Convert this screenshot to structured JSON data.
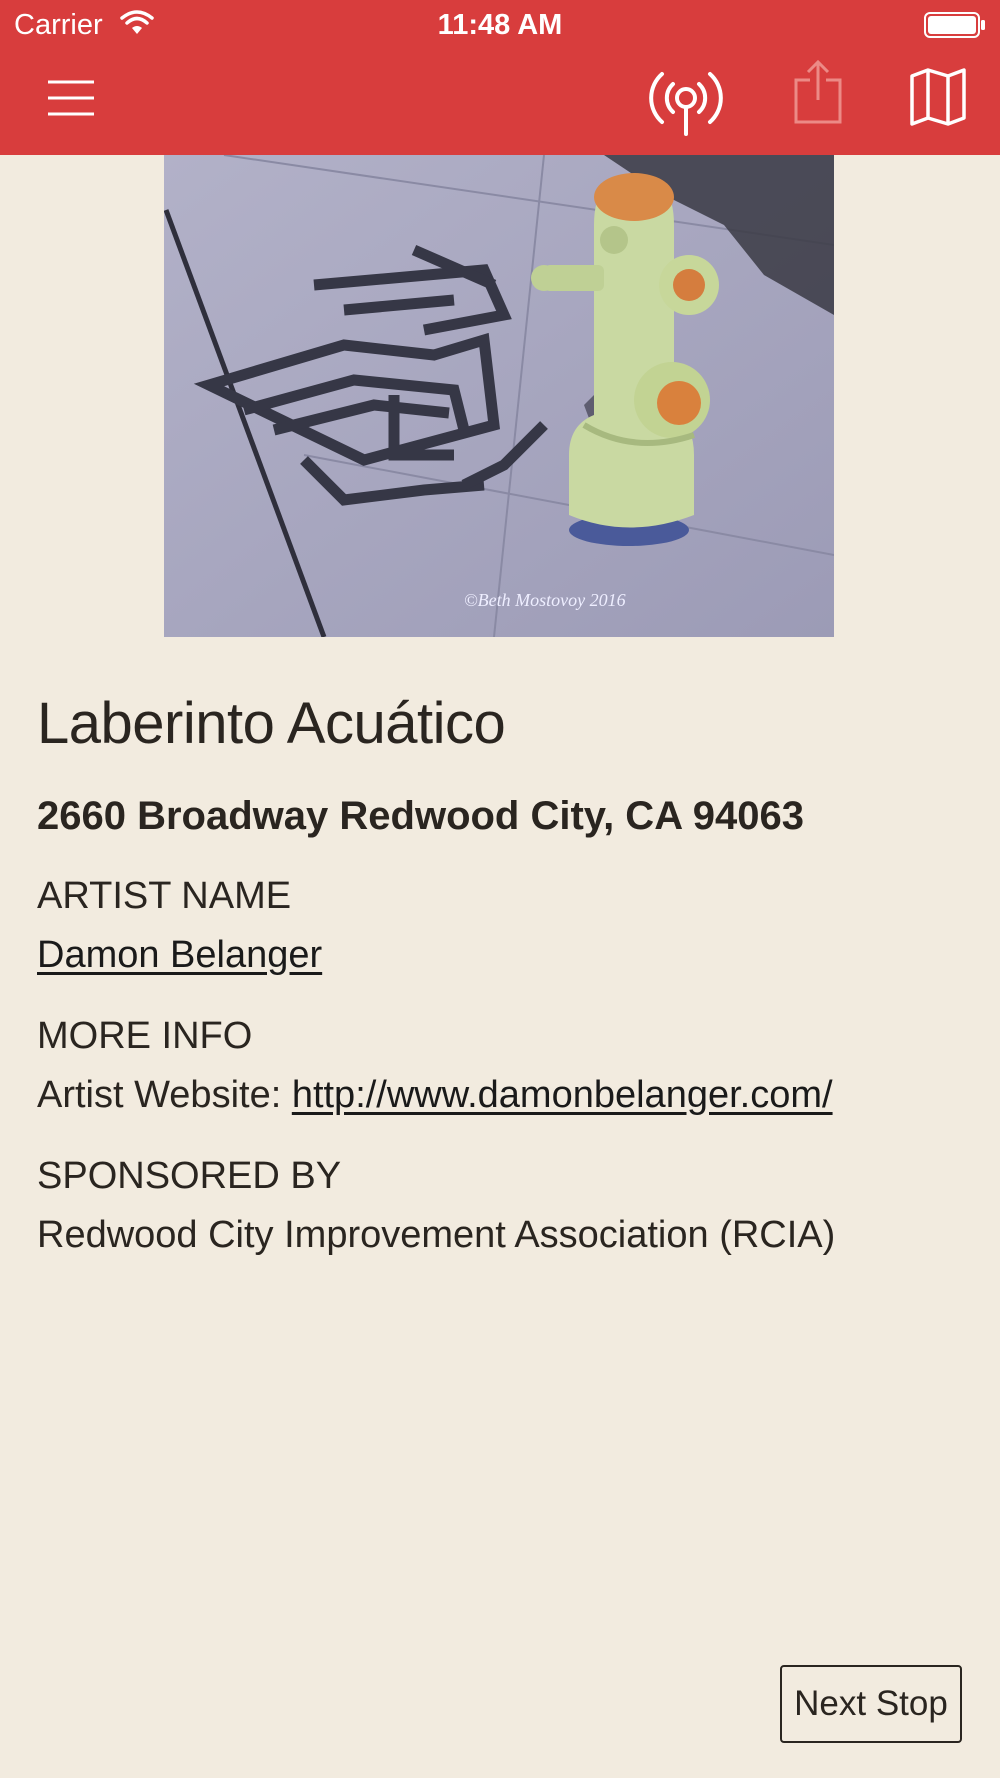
{
  "status_bar": {
    "carrier": "Carrier",
    "time": "11:48 AM"
  },
  "nav": {
    "icons": [
      "hamburger-menu-icon",
      "radio-tower-icon",
      "share-icon",
      "map-icon"
    ]
  },
  "hero": {
    "watermark": "©Beth Mostovoy 2016"
  },
  "art": {
    "title": "Laberinto Acuático",
    "address": "2660 Broadway Redwood City, CA 94063",
    "artist_label": "ARTIST NAME",
    "artist_name": "Damon Belanger",
    "more_info_label": "MORE INFO",
    "website_prefix": "Artist Website: ",
    "website_url": "http://www.damonbelanger.com/",
    "sponsor_label": "SPONSORED BY",
    "sponsor": "Redwood City Improvement Association (RCIA)"
  },
  "footer": {
    "next_stop_label": "Next Stop"
  },
  "colors": {
    "header": "#d83d3d",
    "background": "#f2ebdf",
    "text": "#2a2520"
  }
}
